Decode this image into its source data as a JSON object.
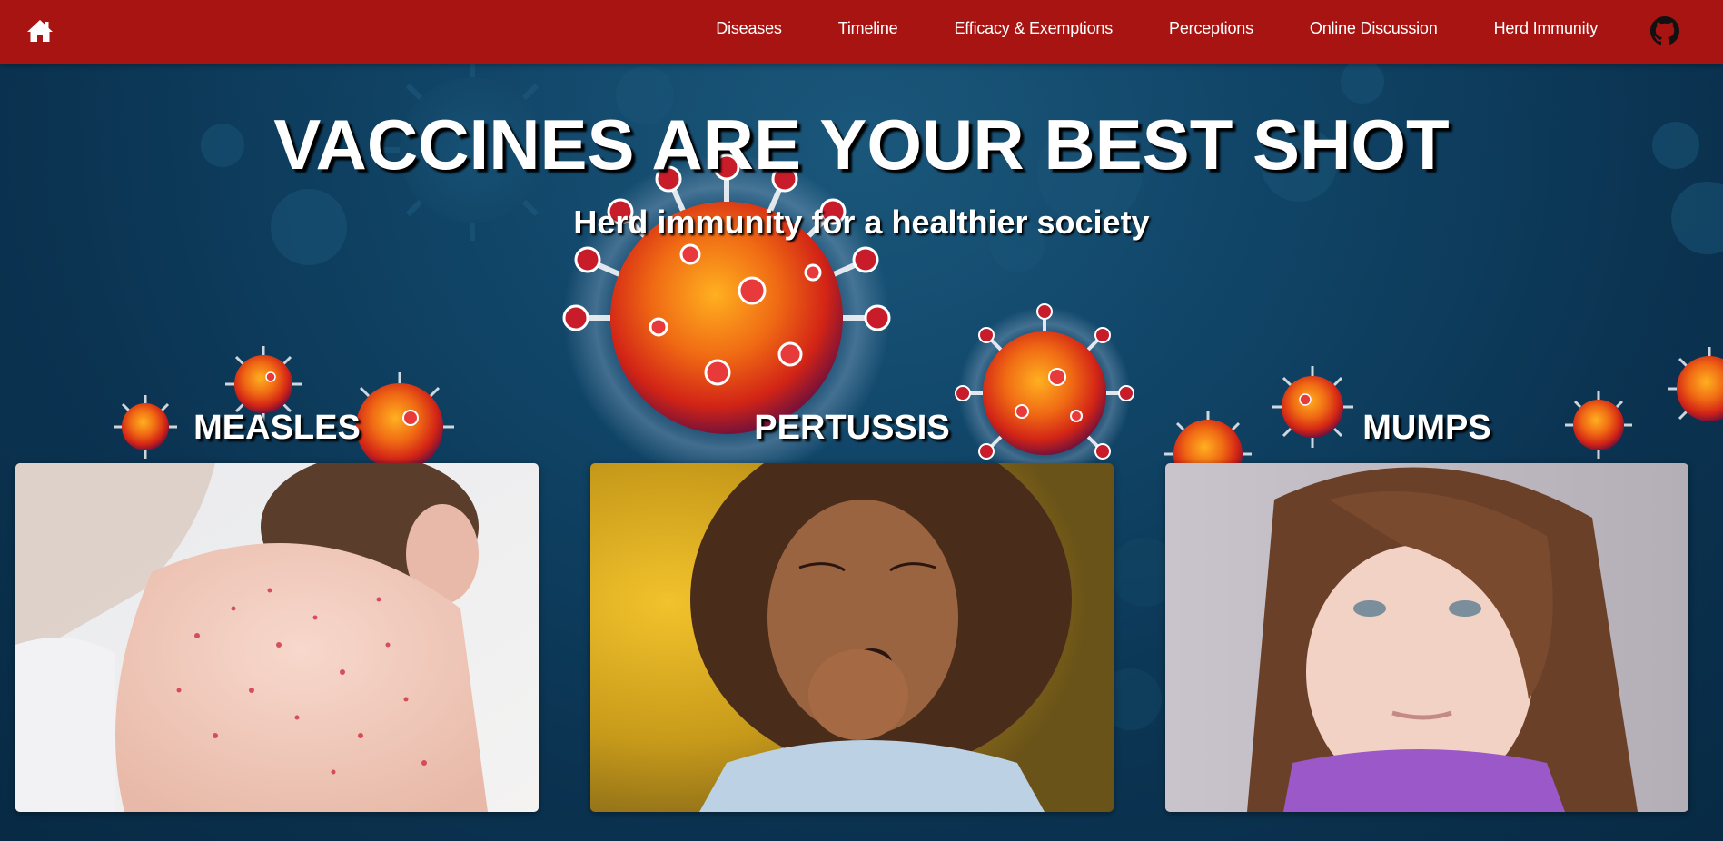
{
  "nav": {
    "home_icon": "home-icon",
    "links": [
      "Diseases",
      "Timeline",
      "Efficacy & Exemptions",
      "Perceptions",
      "Online Discussion",
      "Herd Immunity"
    ],
    "github_icon": "github-icon"
  },
  "hero": {
    "title": "VACCINES ARE YOUR BEST SHOT",
    "subtitle": "Herd immunity for a healthier society"
  },
  "cards": [
    {
      "label": "MEASLES",
      "image": "child-with-measles-rash-photo"
    },
    {
      "label": "PERTUSSIS",
      "image": "child-coughing-photo"
    },
    {
      "label": "MUMPS",
      "image": "child-with-mumps-swelling-photo"
    }
  ],
  "colors": {
    "navbar": "#a81411",
    "hero_background": "#0b3350",
    "virus_core": "#e8501a",
    "text": "#ffffff"
  }
}
